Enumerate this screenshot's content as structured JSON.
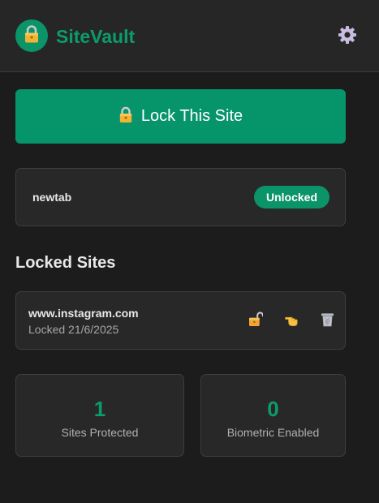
{
  "header": {
    "app_title": "SiteVault",
    "logo_icon": "padlock-icon",
    "settings_icon": "gear-icon"
  },
  "lock_button": {
    "label": "Lock This Site",
    "icon": "padlock-icon"
  },
  "current_site": {
    "domain": "newtab",
    "status": "Unlocked"
  },
  "locked_sites": {
    "title": "Locked Sites",
    "items": [
      {
        "domain": "www.instagram.com",
        "locked_text": "Locked 21/6/2025",
        "actions": [
          "unlock-icon",
          "pointing-hand-icon",
          "trash-icon"
        ]
      }
    ]
  },
  "stats": [
    {
      "value": "1",
      "label": "Sites Protected"
    },
    {
      "value": "0",
      "label": "Biometric Enabled"
    }
  ],
  "colors": {
    "accent": "#06956a",
    "background": "#1c1c1c",
    "card": "#282828"
  }
}
